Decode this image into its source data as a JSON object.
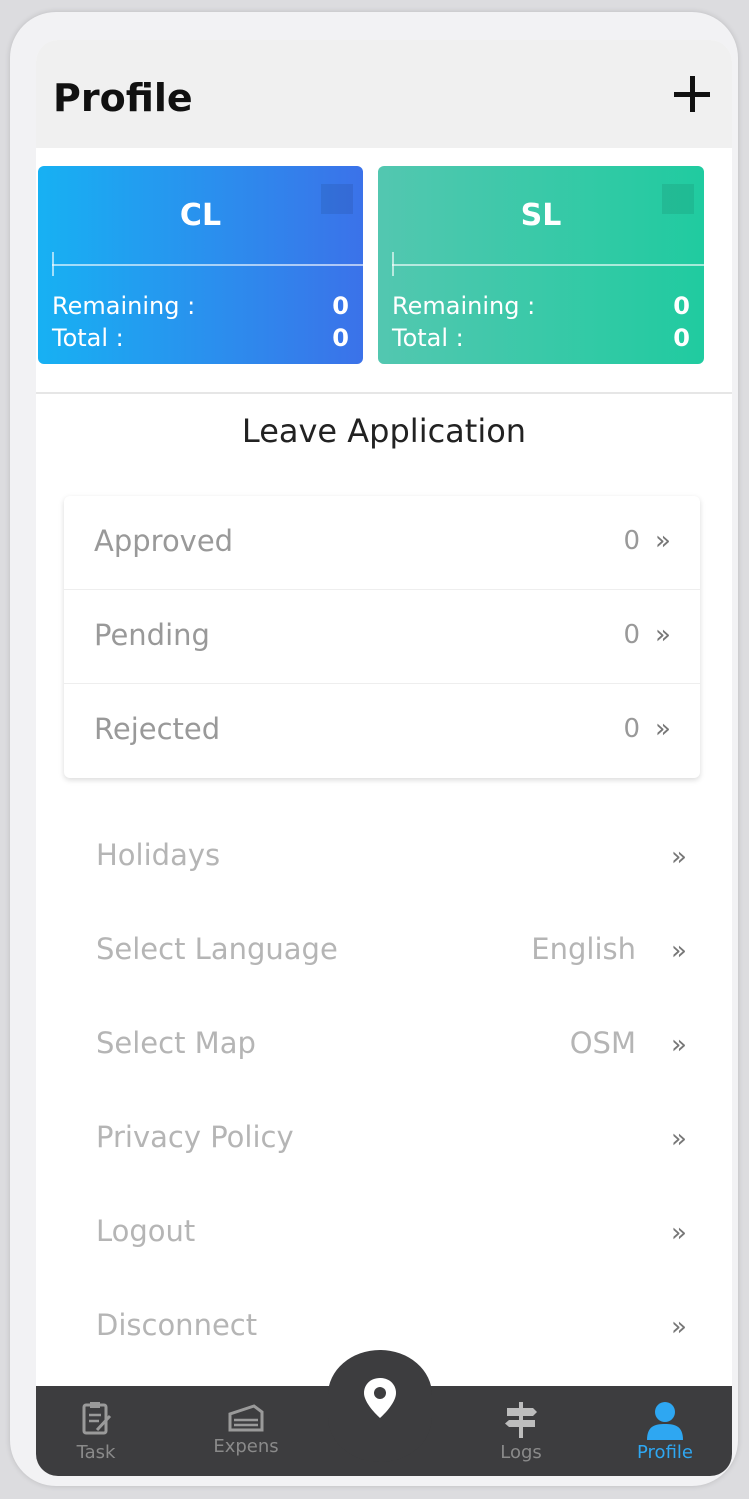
{
  "header": {
    "title": "Profile"
  },
  "cards": [
    {
      "code": "CL",
      "remaining_label": "Remaining :",
      "remaining_value": "0",
      "total_label": "Total :",
      "total_value": "0"
    },
    {
      "code": "SL",
      "remaining_label": "Remaining :",
      "remaining_value": "0",
      "total_label": "Total :",
      "total_value": "0"
    }
  ],
  "leave_application": {
    "title": "Leave Application",
    "statuses": [
      {
        "label": "Approved",
        "count": "0"
      },
      {
        "label": "Pending",
        "count": "0"
      },
      {
        "label": "Rejected",
        "count": "0"
      }
    ]
  },
  "menu": [
    {
      "label": "Holidays",
      "value": ""
    },
    {
      "label": "Select Language",
      "value": "English"
    },
    {
      "label": "Select Map",
      "value": "OSM"
    },
    {
      "label": "Privacy Policy",
      "value": ""
    },
    {
      "label": "Logout",
      "value": ""
    },
    {
      "label": "Disconnect",
      "value": ""
    }
  ],
  "bottom_nav": [
    {
      "label": "Task"
    },
    {
      "label": "Expens"
    },
    {
      "label": "Logs"
    },
    {
      "label": "Profile"
    }
  ],
  "colors": {
    "cl_gradient": [
      "#17b1f3",
      "#3b72e9"
    ],
    "sl_gradient": [
      "#53c7b0",
      "#20cba0"
    ],
    "nav_active": "#2ea7f2",
    "nav_bg": "#3d3d3f"
  },
  "icons": {
    "add": "plus-icon",
    "chevron": "double-chevron-right-icon",
    "task": "clipboard-icon",
    "expense": "receipt-icon",
    "location": "map-pin-icon",
    "logs": "signpost-icon",
    "profile": "user-icon"
  }
}
